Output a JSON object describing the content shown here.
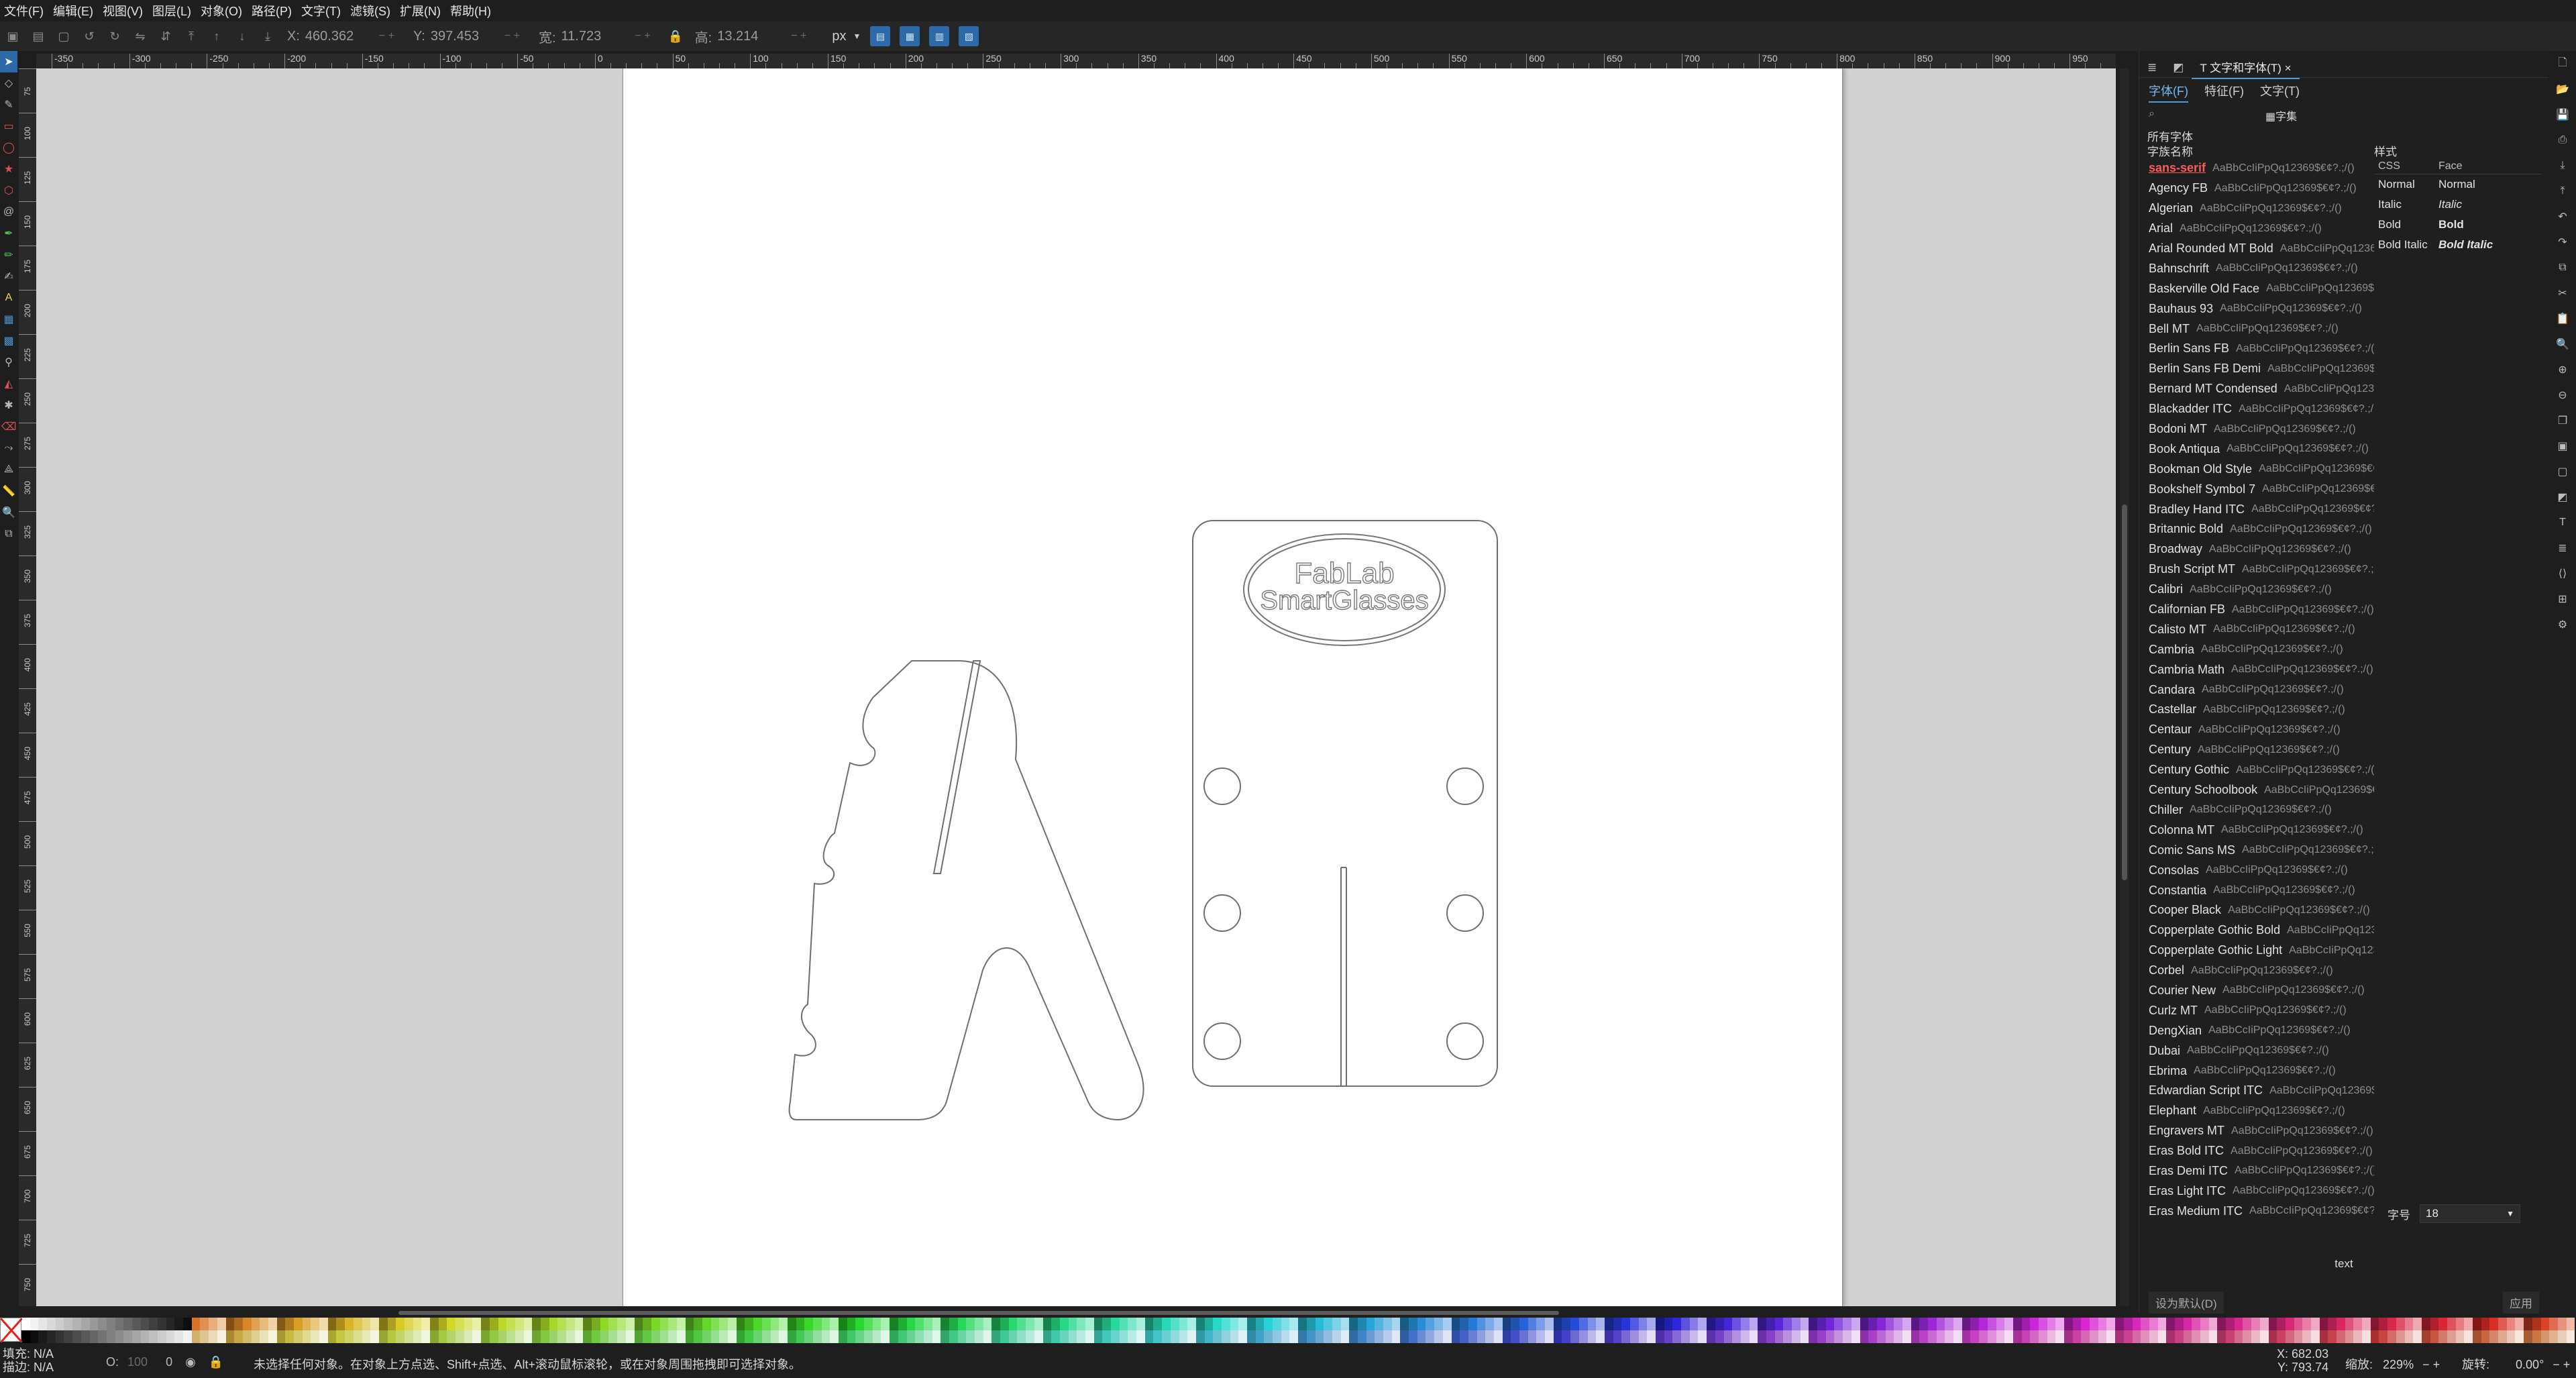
{
  "menu": [
    "文件(F)",
    "编辑(E)",
    "视图(V)",
    "图层(L)",
    "对象(O)",
    "路径(P)",
    "文字(T)",
    "滤镜(S)",
    "扩展(N)",
    "帮助(H)"
  ],
  "toolbar": {
    "x_label": "X:",
    "x_value": "460.362",
    "y_label": "Y:",
    "y_value": "397.453",
    "w_label": "宽:",
    "w_value": "11.723",
    "h_label": "高:",
    "h_value": "13.214",
    "unit": "px"
  },
  "ruler": {
    "h_ticks": [
      "-350",
      "-300",
      "-250",
      "-200",
      "-150",
      "-100",
      "-50",
      "0",
      "50",
      "100",
      "150",
      "200",
      "250",
      "300",
      "350",
      "400",
      "450",
      "500",
      "550",
      "600",
      "650",
      "700",
      "750",
      "800",
      "850",
      "900",
      "950"
    ],
    "v_ticks": [
      "75",
      "100",
      "125",
      "150",
      "175",
      "200",
      "225",
      "250",
      "275",
      "300",
      "325",
      "350",
      "375",
      "400",
      "425",
      "450",
      "475",
      "500",
      "525",
      "550",
      "575",
      "600",
      "625",
      "650",
      "675",
      "700",
      "725",
      "750"
    ]
  },
  "canvas": {
    "logo_line1": "FabLab",
    "logo_line2": "SmartGlasses"
  },
  "panel": {
    "tab_text_font": "文字和字体(T)",
    "subtab_font": "字体(F)",
    "subtab_features": "特征(F)",
    "subtab_text": "文字(T)",
    "charset_button": "字集",
    "all_fonts": "所有字体",
    "family_header": "字族名称",
    "style_header": "样式",
    "style_col_css": "CSS",
    "style_col_face": "Face",
    "styles": [
      {
        "css": "Normal",
        "face": "Normal"
      },
      {
        "css": "Italic",
        "face": "Italic"
      },
      {
        "css": "Bold",
        "face": "Bold"
      },
      {
        "css": "Bold Italic",
        "face": "Bold Italic"
      }
    ],
    "sample": "AaBbCcIiPpQq12369$€¢?.;/()",
    "fonts": [
      "sans-serif",
      "Agency FB",
      "Algerian",
      "Arial",
      "Arial Rounded MT Bold",
      "Bahnschrift",
      "Baskerville Old Face",
      "Bauhaus 93",
      "Bell MT",
      "Berlin Sans FB",
      "Berlin Sans FB Demi",
      "Bernard MT Condensed",
      "Blackadder ITC",
      "Bodoni MT",
      "Book Antiqua",
      "Bookman Old Style",
      "Bookshelf Symbol 7",
      "Bradley Hand ITC",
      "Britannic Bold",
      "Broadway",
      "Brush Script MT",
      "Calibri",
      "Californian FB",
      "Calisto MT",
      "Cambria",
      "Cambria Math",
      "Candara",
      "Castellar",
      "Centaur",
      "Century",
      "Century Gothic",
      "Century Schoolbook",
      "Chiller",
      "Colonna MT",
      "Comic Sans MS",
      "Consolas",
      "Constantia",
      "Cooper Black",
      "Copperplate Gothic Bold",
      "Copperplate Gothic Light",
      "Corbel",
      "Courier New",
      "Curlz MT",
      "DengXian",
      "Dubai",
      "Ebrima",
      "Edwardian Script ITC",
      "Elephant",
      "Engravers MT",
      "Eras Bold ITC",
      "Eras Demi ITC",
      "Eras Light ITC",
      "Eras Medium ITC"
    ],
    "size_label": "字号",
    "size_value": "18",
    "preview": "text",
    "set_default": "设为默认(D)",
    "apply": "应用"
  },
  "status": {
    "fill_label": "填充:",
    "fill_value": "N/A",
    "stroke_label": "描边:",
    "stroke_value": "N/A",
    "opacity_label": "O:",
    "opacity_value": "100",
    "layer_value": "0",
    "message": "未选择任何对象。在对象上方点选、Shift+点选、Alt+滚动鼠标滚轮，或在对象周围拖拽即可选择对象。",
    "x_label": "X:",
    "x_value": "682.03",
    "y_label": "Y:",
    "y_value": "793.74",
    "zoom_label": "缩放:",
    "zoom_value": "229%",
    "rotate_label": "旋转:",
    "rotate_value": "0.00°"
  }
}
